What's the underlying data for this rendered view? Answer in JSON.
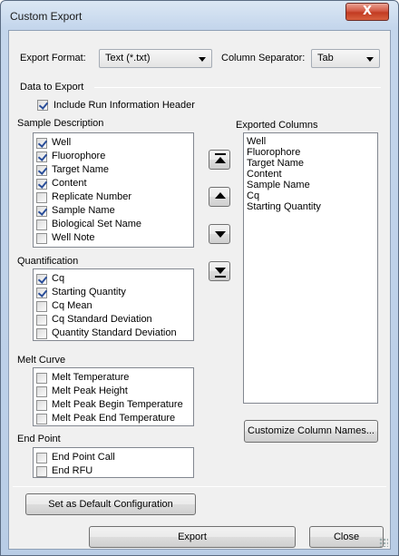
{
  "window": {
    "title": "Custom Export",
    "close_glyph": "X"
  },
  "export_format": {
    "label": "Export Format:",
    "value": "Text (*.txt)"
  },
  "column_separator": {
    "label": "Column Separator:",
    "value": "Tab"
  },
  "data_to_export": {
    "heading": "Data to Export",
    "include_header": {
      "label": "Include Run Information Header",
      "checked": true
    }
  },
  "sample_description": {
    "heading": "Sample Description",
    "items": [
      {
        "label": "Well",
        "checked": true
      },
      {
        "label": "Fluorophore",
        "checked": true
      },
      {
        "label": "Target Name",
        "checked": true
      },
      {
        "label": "Content",
        "checked": true
      },
      {
        "label": "Replicate Number",
        "checked": false
      },
      {
        "label": "Sample Name",
        "checked": true
      },
      {
        "label": "Biological Set Name",
        "checked": false
      },
      {
        "label": "Well Note",
        "checked": false
      }
    ]
  },
  "quantification": {
    "heading": "Quantification",
    "items": [
      {
        "label": "Cq",
        "checked": true
      },
      {
        "label": "Starting Quantity",
        "checked": true
      },
      {
        "label": "Cq Mean",
        "checked": false
      },
      {
        "label": "Cq Standard Deviation",
        "checked": false
      },
      {
        "label": "Quantity Standard Deviation",
        "checked": false
      }
    ]
  },
  "melt_curve": {
    "heading": "Melt Curve",
    "items": [
      {
        "label": "Melt Temperature",
        "checked": false
      },
      {
        "label": "Melt Peak Height",
        "checked": false
      },
      {
        "label": "Melt Peak Begin Temperature",
        "checked": false
      },
      {
        "label": "Melt Peak End Temperature",
        "checked": false
      }
    ]
  },
  "end_point": {
    "heading": "End Point",
    "items": [
      {
        "label": "End Point Call",
        "checked": false
      },
      {
        "label": "End RFU",
        "checked": false
      }
    ]
  },
  "exported_columns": {
    "heading": "Exported Columns",
    "items": [
      "Well",
      "Fluorophore",
      "Target Name",
      "Content",
      "Sample Name",
      "Cq",
      "Starting Quantity"
    ]
  },
  "buttons": {
    "customize": "Customize Column Names...",
    "set_default": "Set as Default Configuration",
    "export": "Export",
    "close": "Close"
  },
  "icons": {
    "move_top": "move-to-top-icon",
    "move_up": "move-up-icon",
    "move_down": "move-down-icon",
    "move_bottom": "move-to-bottom-icon"
  }
}
